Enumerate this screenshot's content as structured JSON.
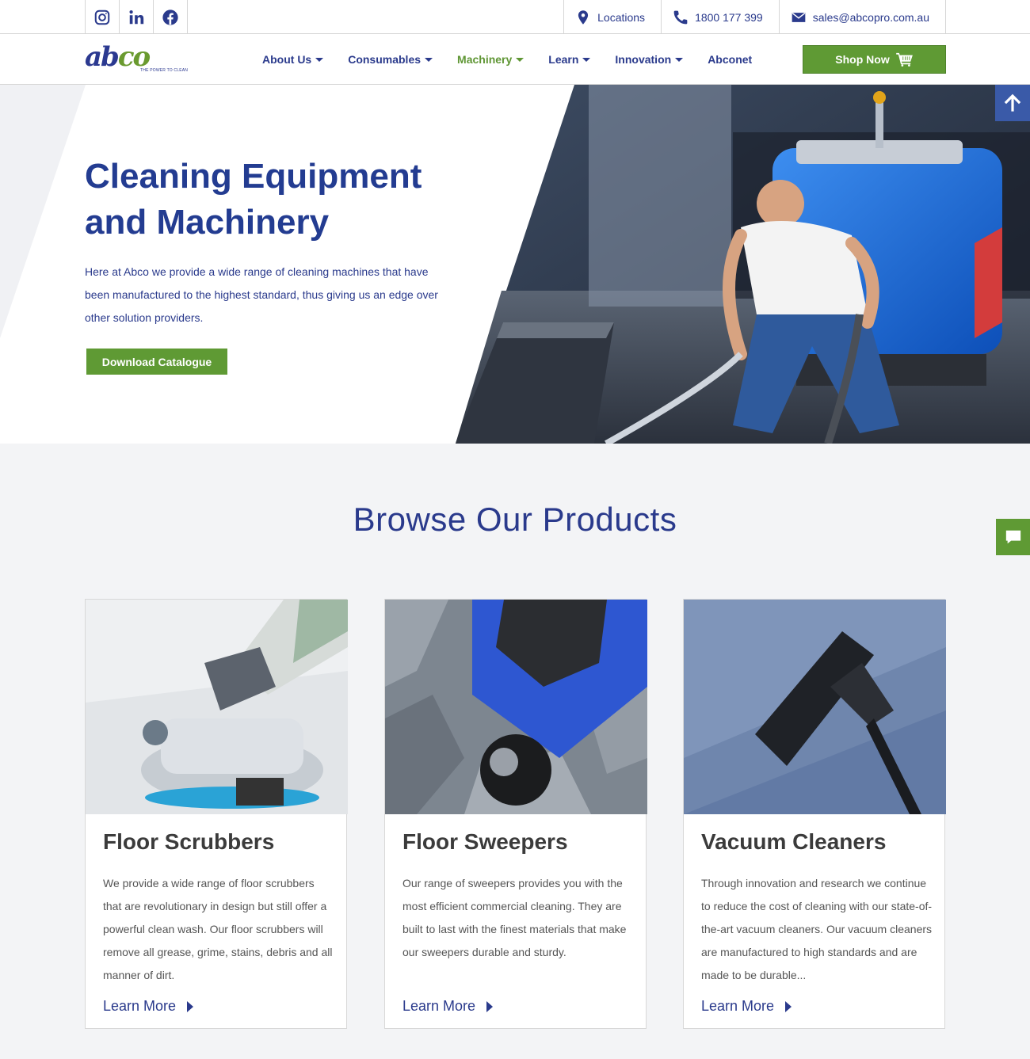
{
  "topbar": {
    "social": [
      {
        "icon": "instagram-icon"
      },
      {
        "icon": "linkedin-icon"
      },
      {
        "icon": "facebook-icon"
      }
    ],
    "locations": "Locations",
    "phone": "1800 177 399",
    "email": "sales@abcopro.com.au"
  },
  "nav": {
    "logo": {
      "brand": "abco",
      "tagline": "THE POWER TO CLEAN"
    },
    "items": [
      {
        "label": "About Us",
        "dropdown": true
      },
      {
        "label": "Consumables",
        "dropdown": true
      },
      {
        "label": "Machinery",
        "dropdown": true,
        "active": true
      },
      {
        "label": "Learn",
        "dropdown": true
      },
      {
        "label": "Innovation",
        "dropdown": true
      },
      {
        "label": "Abconet",
        "dropdown": false
      }
    ],
    "shop_label": "Shop Now"
  },
  "hero": {
    "title_line1": "Cleaning Equipment",
    "title_line2": "and Machinery",
    "text": "Here at Abco we provide a wide range of cleaning machines that have been manufactured to the highest standard, thus giving us an edge over other solution providers.",
    "button": "Download Catalogue"
  },
  "browse": {
    "title": "Browse Our Products",
    "cards": [
      {
        "title": "Floor Scrubbers",
        "text": "We provide a wide range of floor scrubbers that are revolutionary in design but still offer a powerful clean wash. Our floor scrubbers will remove all grease, grime, stains, debris and all manner of dirt.",
        "link": "Learn More"
      },
      {
        "title": "Floor Sweepers",
        "text": "Our range of sweepers provides you with the most efficient commercial cleaning. They are built to last with the finest materials that make our sweepers durable and sturdy.",
        "link": "Learn More"
      },
      {
        "title": "Vacuum Cleaners",
        "text": "Through innovation and research we continue to reduce the cost of cleaning with our state-of-the-art vacuum cleaners. Our vacuum cleaners are manufactured to high standards and are made to be durable...",
        "link": "Learn More"
      }
    ]
  },
  "colors": {
    "brand_blue": "#2a3a8c",
    "brand_green": "#5f9a34",
    "page_bg": "#f3f4f6"
  }
}
